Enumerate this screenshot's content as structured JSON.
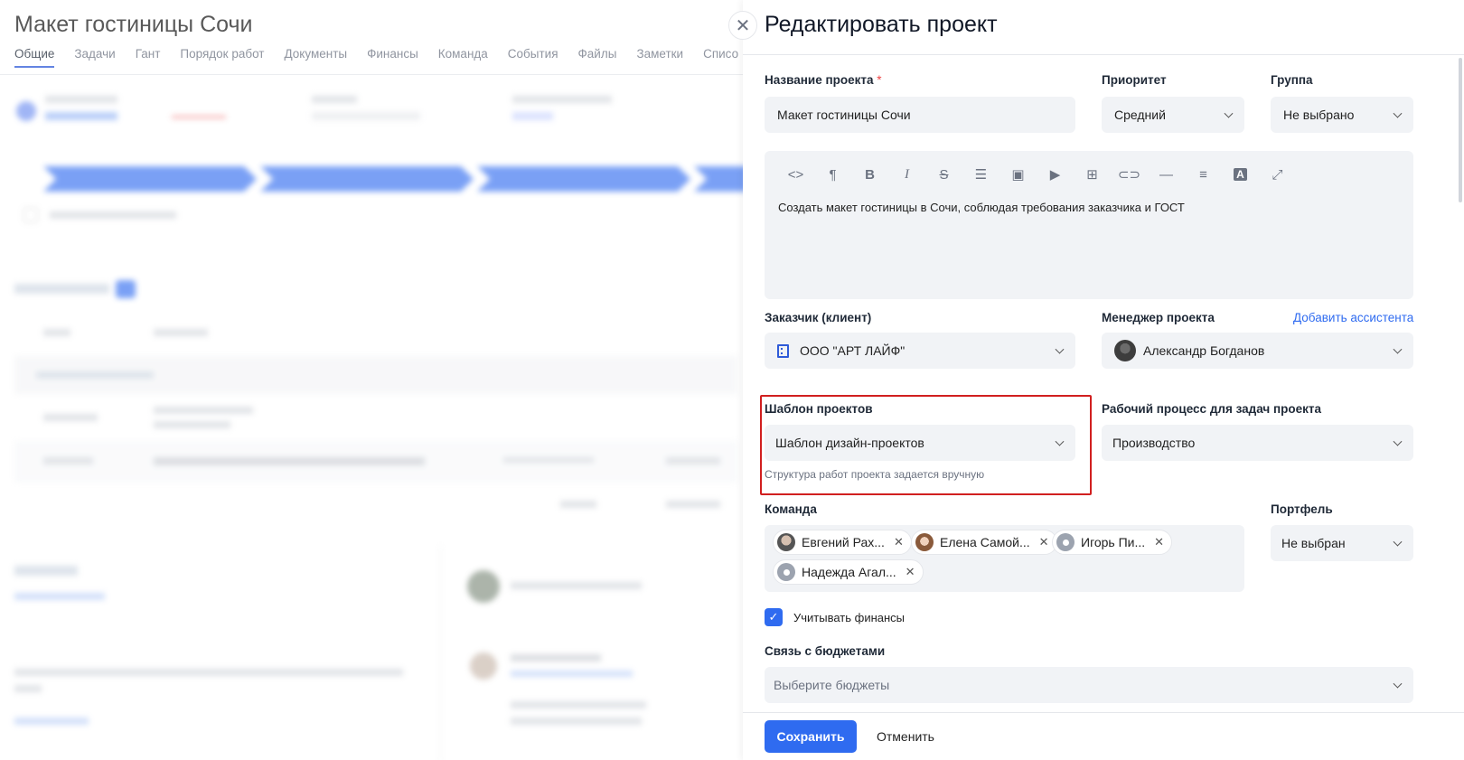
{
  "background": {
    "title": "Макет гостиницы Сочи",
    "tabs": [
      "Общие",
      "Задачи",
      "Гант",
      "Порядок работ",
      "Документы",
      "Финансы",
      "Команда",
      "События",
      "Файлы",
      "Заметки",
      "Списо"
    ],
    "active_tab": "Общие"
  },
  "panel": {
    "title": "Редактировать проект",
    "close_glyph": "✕",
    "project_name": {
      "label": "Название проекта",
      "required_mark": "*",
      "value": "Макет гостиницы Сочи"
    },
    "priority": {
      "label": "Приоритет",
      "value": "Средний"
    },
    "group": {
      "label": "Группа",
      "value": "Не выбрано"
    },
    "editor": {
      "toolbar": [
        "code-icon",
        "paragraph-icon",
        "bold-icon",
        "italic-icon",
        "strikethrough-icon",
        "list-icon",
        "image-icon",
        "video-icon",
        "table-icon",
        "link-icon",
        "horizontal-rule-icon",
        "align-icon",
        "text-color-icon",
        "fullscreen-icon"
      ],
      "text": "Создать макет гостиницы в Сочи, соблюдая требования заказчика и ГОСТ"
    },
    "customer": {
      "label": "Заказчик (клиент)",
      "value": "ООО \"АРТ ЛАЙФ\""
    },
    "manager": {
      "label": "Менеджер проекта",
      "add_assistant": "Добавить ассистента",
      "value": "Александр Богданов"
    },
    "template": {
      "label": "Шаблон проектов",
      "value": "Шаблон дизайн-проектов",
      "hint": "Структура работ проекта задается вручную"
    },
    "workflow": {
      "label": "Рабочий процесс для задач проекта",
      "value": "Производство"
    },
    "team": {
      "label": "Команда",
      "members": [
        "Евгений Рах...",
        "Елена Самой...",
        "Игорь Пи...",
        "Надежда Агал..."
      ]
    },
    "portfolio": {
      "label": "Портфель",
      "value": "Не выбран"
    },
    "finance_checkbox": {
      "label": "Учитывать финансы",
      "checked": true
    },
    "budgets": {
      "label": "Связь с бюджетами",
      "placeholder": "Выберите бюджеты"
    },
    "save_label": "Сохранить",
    "cancel_label": "Отменить"
  },
  "colors": {
    "accent": "#2f6bf0",
    "highlight": "#d11f1f",
    "field_bg": "#f1f3f6"
  }
}
